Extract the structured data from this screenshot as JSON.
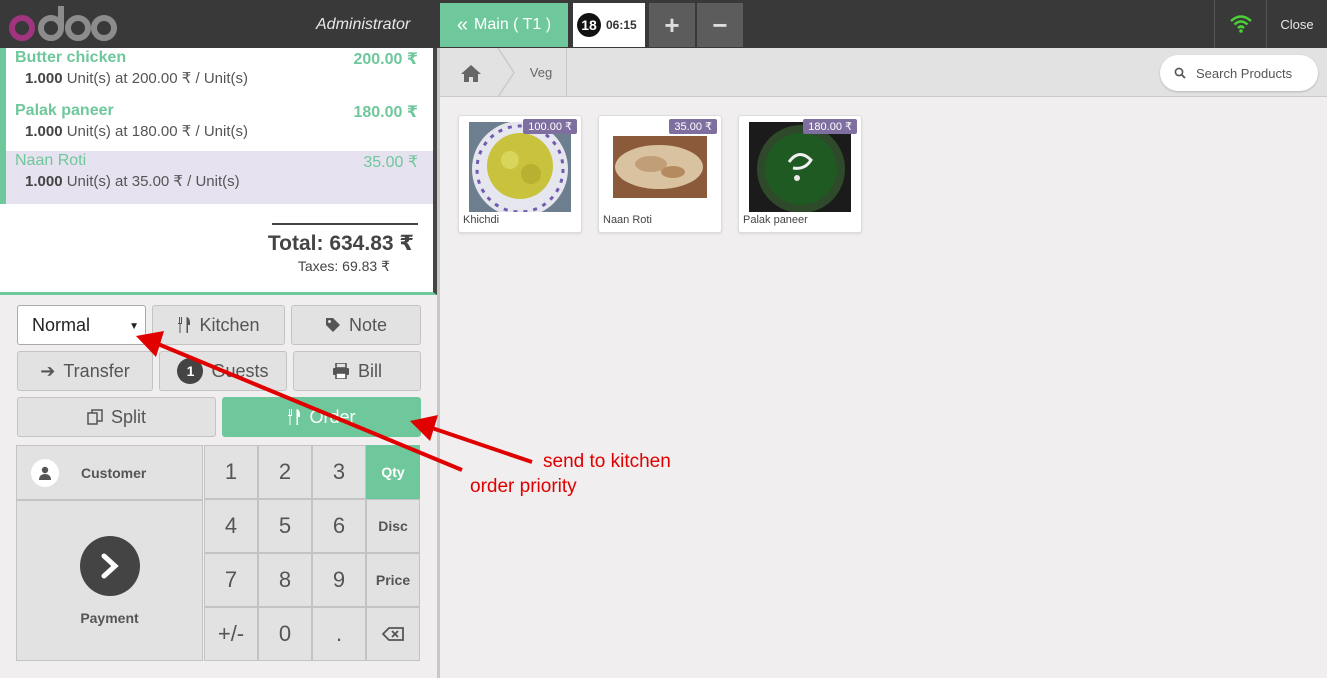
{
  "topbar": {
    "logo_text": "odoo",
    "user": "Administrator",
    "order_tab": "Main ( T1 )",
    "time_badge": "18",
    "time": "06:15",
    "add_label": "+",
    "remove_label": "−",
    "close_label": "Close",
    "colors": {
      "accent": "#6ec89b",
      "bar": "#393939",
      "wifi": "#4cd137"
    }
  },
  "order": {
    "lines": [
      {
        "name": "Butter chicken",
        "price": "200.00 ₹",
        "qty": "1.000",
        "unit_text": "Unit(s) at 200.00 ₹ / Unit(s)",
        "selected": false
      },
      {
        "name": "Palak paneer",
        "price": "180.00 ₹",
        "qty": "1.000",
        "unit_text": "Unit(s) at 180.00 ₹ / Unit(s)",
        "selected": false
      },
      {
        "name": "Naan Roti",
        "price": "35.00 ₹",
        "qty": "1.000",
        "unit_text": "Unit(s) at 35.00 ₹ / Unit(s)",
        "selected": true
      }
    ],
    "total": "Total: 634.83 ₹",
    "taxes": "Taxes: 69.83 ₹"
  },
  "controls": {
    "priority": "Normal",
    "kitchen": "Kitchen",
    "note": "Note",
    "transfer": "Transfer",
    "guests_count": "1",
    "guests": "Guests",
    "bill": "Bill",
    "split": "Split",
    "order": "Order"
  },
  "pad": {
    "customer": "Customer",
    "payment": "Payment",
    "keys": [
      "1",
      "2",
      "3",
      "4",
      "5",
      "6",
      "7",
      "8",
      "9",
      "+/-",
      "0",
      "."
    ],
    "qty": "Qty",
    "disc": "Disc",
    "price": "Price"
  },
  "products": {
    "breadcrumb": "Veg",
    "search_placeholder": "Search Products",
    "items": [
      {
        "name": "Khichdi",
        "price": "100.00 ₹"
      },
      {
        "name": "Naan Roti",
        "price": "35.00 ₹"
      },
      {
        "name": "Palak paneer",
        "price": "180.00 ₹"
      }
    ]
  },
  "annotations": {
    "send_to_kitchen": "send to kitchen",
    "order_priority": "order priority",
    "color": "#e00000"
  }
}
